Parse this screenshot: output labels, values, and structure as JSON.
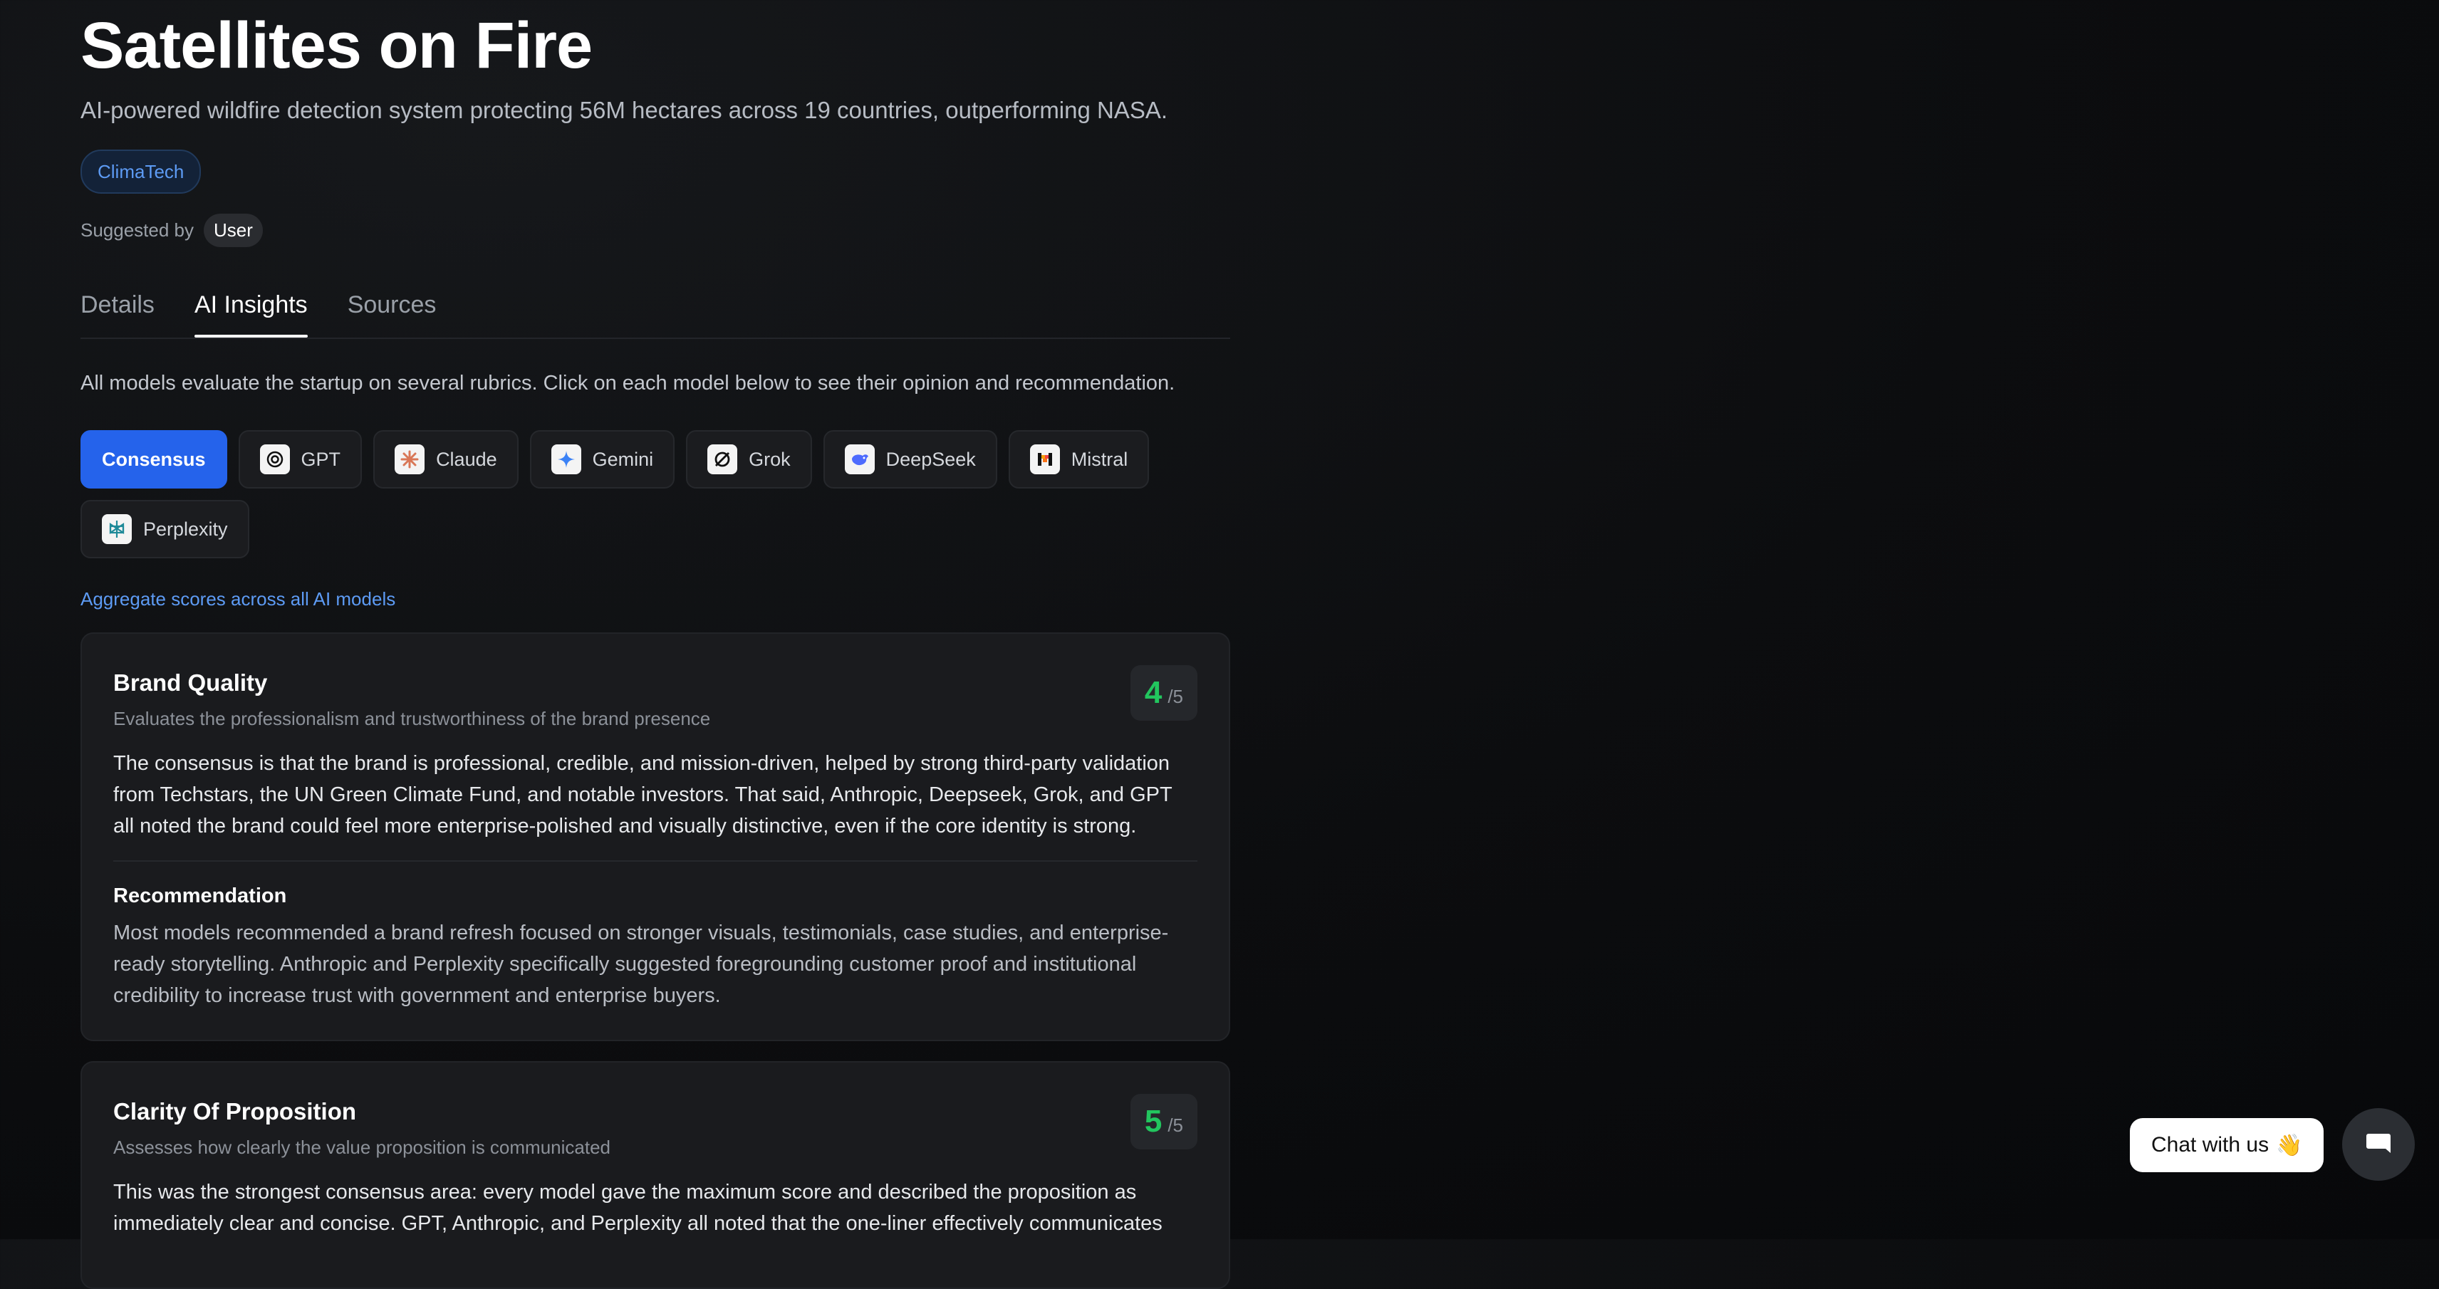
{
  "header": {
    "title": "Satellites on Fire",
    "subtitle": "AI-powered wildfire detection system protecting 56M hectares across 19 countries, outperforming NASA.",
    "tag": "ClimaTech",
    "suggested_label": "Suggested by",
    "suggested_user": "User"
  },
  "tabs": [
    {
      "label": "Details",
      "active": false
    },
    {
      "label": "AI Insights",
      "active": true
    },
    {
      "label": "Sources",
      "active": false
    }
  ],
  "intro": "All models evaluate the startup on several rubrics. Click on each model below to see their opinion and recommendation.",
  "models": [
    {
      "label": "Consensus",
      "icon": "none",
      "active": true
    },
    {
      "label": "GPT",
      "icon": "openai-icon"
    },
    {
      "label": "Claude",
      "icon": "claude-icon"
    },
    {
      "label": "Gemini",
      "icon": "gemini-icon"
    },
    {
      "label": "Grok",
      "icon": "grok-icon"
    },
    {
      "label": "DeepSeek",
      "icon": "deepseek-icon"
    },
    {
      "label": "Mistral",
      "icon": "mistral-icon"
    },
    {
      "label": "Perplexity",
      "icon": "perplexity-icon"
    }
  ],
  "aggregate_link": "Aggregate scores across all AI models",
  "rubrics": [
    {
      "title": "Brand Quality",
      "description": "Evaluates the professionalism and trustworthiness of the brand presence",
      "score": "4",
      "score_max": "/5",
      "body": "The consensus is that the brand is professional, credible, and mission-driven, helped by strong third-party validation from Techstars, the UN Green Climate Fund, and notable investors. That said, Anthropic, Deepseek, Grok, and GPT all noted the brand could feel more enterprise-polished and visually distinctive, even if the core identity is strong.",
      "recommendation_title": "Recommendation",
      "recommendation": "Most models recommended a brand refresh focused on stronger visuals, testimonials, case studies, and enterprise-ready storytelling. Anthropic and Perplexity specifically suggested foregrounding customer proof and institutional credibility to increase trust with government and enterprise buyers."
    },
    {
      "title": "Clarity Of Proposition",
      "description": "Assesses how clearly the value proposition is communicated",
      "score": "5",
      "score_max": "/5",
      "body": "This was the strongest consensus area: every model gave the maximum score and described the proposition as immediately clear and concise. GPT, Anthropic, and Perplexity all noted that the one-liner effectively communicates"
    }
  ],
  "chat": {
    "label": "Chat with us",
    "emoji": "👋"
  },
  "colors": {
    "accent": "#2563eb",
    "score": "#22c55e",
    "link": "#5d9bf4"
  }
}
